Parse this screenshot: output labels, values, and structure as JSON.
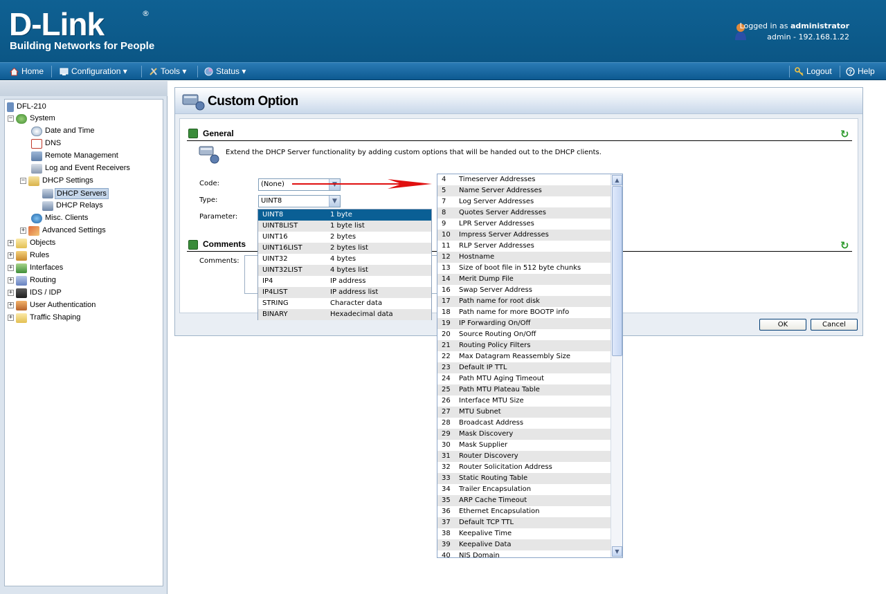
{
  "header": {
    "logo_main": "D-Link",
    "logo_reg": "®",
    "logo_tagline": "Building Networks for People",
    "login_prefix": "Logged in as ",
    "login_user": "administrator",
    "login_host": "admin - 192.168.1.22"
  },
  "menu": {
    "home": "Home",
    "configuration": "Configuration ▾",
    "tools": "Tools ▾",
    "status": "Status ▾",
    "logout": "Logout",
    "help": "Help"
  },
  "tree": {
    "root": "DFL-210",
    "system": "System",
    "date_time": "Date and Time",
    "dns": "DNS",
    "remote_mgmt": "Remote Management",
    "log_receivers": "Log and Event Receivers",
    "dhcp_settings": "DHCP Settings",
    "dhcp_servers": "DHCP Servers",
    "dhcp_relays": "DHCP Relays",
    "misc_clients": "Misc. Clients",
    "advanced": "Advanced Settings",
    "objects": "Objects",
    "rules": "Rules",
    "interfaces": "Interfaces",
    "routing": "Routing",
    "ids_idp": "IDS / IDP",
    "user_auth": "User Authentication",
    "traffic_shaping": "Traffic Shaping"
  },
  "panel": {
    "title": "Custom Option",
    "general": "General",
    "description": "Extend the DHCP Server functionality by adding custom options that will be handed out to the DHCP clients.",
    "code_label": "Code:",
    "code_value": "(None)",
    "type_label": "Type:",
    "type_value": "UINT8",
    "parameter_label": "Parameter:",
    "comments_head": "Comments",
    "comments_label": "Comments:",
    "ok": "OK",
    "cancel": "Cancel"
  },
  "type_options": [
    {
      "name": "UINT8",
      "desc": "1 byte"
    },
    {
      "name": "UINT8LIST",
      "desc": "1 byte list"
    },
    {
      "name": "UINT16",
      "desc": "2 bytes"
    },
    {
      "name": "UINT16LIST",
      "desc": "2 bytes list"
    },
    {
      "name": "UINT32",
      "desc": "4 bytes"
    },
    {
      "name": "UINT32LIST",
      "desc": "4 bytes list"
    },
    {
      "name": "IP4",
      "desc": "IP address"
    },
    {
      "name": "IP4LIST",
      "desc": "IP address list"
    },
    {
      "name": "STRING",
      "desc": "Character data"
    },
    {
      "name": "BINARY",
      "desc": "Hexadecimal data"
    }
  ],
  "code_options": [
    {
      "num": "4",
      "name": "Timeserver Addresses"
    },
    {
      "num": "5",
      "name": "Name Server Addresses"
    },
    {
      "num": "7",
      "name": "Log Server Addresses"
    },
    {
      "num": "8",
      "name": "Quotes Server Addresses"
    },
    {
      "num": "9",
      "name": "LPR Server Addresses"
    },
    {
      "num": "10",
      "name": "Impress Server Addresses"
    },
    {
      "num": "11",
      "name": "RLP Server Addresses"
    },
    {
      "num": "12",
      "name": "Hostname"
    },
    {
      "num": "13",
      "name": "Size of boot file in 512 byte chunks"
    },
    {
      "num": "14",
      "name": "Merit Dump File"
    },
    {
      "num": "16",
      "name": "Swap Server Address"
    },
    {
      "num": "17",
      "name": "Path name for root disk"
    },
    {
      "num": "18",
      "name": "Path name for more BOOTP info"
    },
    {
      "num": "19",
      "name": "IP Forwarding On/Off"
    },
    {
      "num": "20",
      "name": "Source Routing On/Off"
    },
    {
      "num": "21",
      "name": "Routing Policy Filters"
    },
    {
      "num": "22",
      "name": "Max Datagram Reassembly Size"
    },
    {
      "num": "23",
      "name": "Default IP TTL"
    },
    {
      "num": "24",
      "name": "Path MTU Aging Timeout"
    },
    {
      "num": "25",
      "name": "Path MTU Plateau Table"
    },
    {
      "num": "26",
      "name": "Interface MTU Size"
    },
    {
      "num": "27",
      "name": "MTU Subnet"
    },
    {
      "num": "28",
      "name": "Broadcast Address"
    },
    {
      "num": "29",
      "name": "Mask Discovery"
    },
    {
      "num": "30",
      "name": "Mask Supplier"
    },
    {
      "num": "31",
      "name": "Router Discovery"
    },
    {
      "num": "32",
      "name": "Router Solicitation Address"
    },
    {
      "num": "33",
      "name": "Static Routing Table"
    },
    {
      "num": "34",
      "name": "Trailer Encapsulation"
    },
    {
      "num": "35",
      "name": "ARP Cache Timeout"
    },
    {
      "num": "36",
      "name": "Ethernet Encapsulation"
    },
    {
      "num": "37",
      "name": "Default TCP TTL"
    },
    {
      "num": "38",
      "name": "Keepalive Time"
    },
    {
      "num": "39",
      "name": "Keepalive Data"
    },
    {
      "num": "40",
      "name": "NIS Domain"
    }
  ],
  "colors": {
    "header_bg": "#0e5d8f",
    "selected_row": "#0a5f95",
    "annotation_arrow": "#e01010"
  }
}
